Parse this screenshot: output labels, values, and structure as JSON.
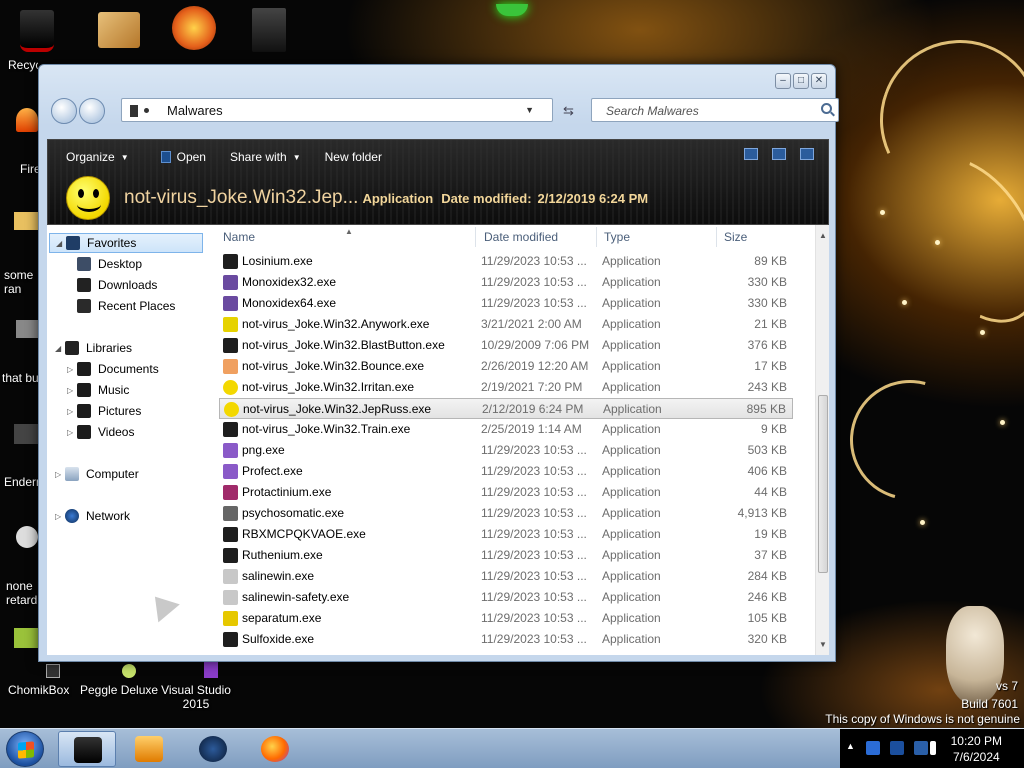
{
  "desktop": {
    "icons_bottom": [
      {
        "label": "ChomikBox"
      },
      {
        "label": "Peggle Deluxe"
      },
      {
        "label": "Visual Studio 2015"
      }
    ],
    "partial_labels": [
      {
        "label": "Recycle Bin"
      },
      {
        "label": "Fire"
      },
      {
        "label": "some ran"
      },
      {
        "label": "that bu"
      },
      {
        "label": "Endern"
      },
      {
        "label": "none retard"
      }
    ],
    "watermark": {
      "version": "vs 7",
      "build": "Build 7601",
      "genuine": "This copy of Windows is not genuine"
    }
  },
  "window": {
    "address": {
      "path": "Malwares"
    },
    "search": {
      "placeholder": "Search Malwares"
    },
    "toolbar": {
      "organize": "Organize",
      "open": "Open",
      "share_with": "Share with",
      "new_folder": "New folder"
    },
    "details": {
      "filename": "not-virus_Joke.Win32.Jep...",
      "type": "Application",
      "date_modified_label": "Date modified:",
      "date_modified_value": "2/12/2019 6:24 PM"
    },
    "nav": {
      "favorites": "Favorites",
      "desktop": "Desktop",
      "downloads": "Downloads",
      "recent_places": "Recent Places",
      "libraries": "Libraries",
      "documents": "Documents",
      "music": "Music",
      "pictures": "Pictures",
      "videos": "Videos",
      "computer": "Computer",
      "network": "Network"
    },
    "columns": {
      "name": "Name",
      "date": "Date modified",
      "type": "Type",
      "size": "Size"
    },
    "files": [
      {
        "name": "Losinium.exe",
        "date": "11/29/2023 10:53 ...",
        "type": "Application",
        "size": "89 KB",
        "icon": "dark-terminal-icon"
      },
      {
        "name": "Monoxidex32.exe",
        "date": "11/29/2023 10:53 ...",
        "type": "Application",
        "size": "330 KB",
        "icon": "gear-app-icon"
      },
      {
        "name": "Monoxidex64.exe",
        "date": "11/29/2023 10:53 ...",
        "type": "Application",
        "size": "330 KB",
        "icon": "gear-app-icon"
      },
      {
        "name": "not-virus_Joke.Win32.Anywork.exe",
        "date": "3/21/2021 2:00 AM",
        "type": "Application",
        "size": "21 KB",
        "icon": "pencil-icon"
      },
      {
        "name": "not-virus_Joke.Win32.BlastButton.exe",
        "date": "10/29/2009 7:06 PM",
        "type": "Application",
        "size": "376 KB",
        "icon": "dark-terminal-icon"
      },
      {
        "name": "not-virus_Joke.Win32.Bounce.exe",
        "date": "2/26/2019 12:20 AM",
        "type": "Application",
        "size": "17 KB",
        "icon": "orange-app-icon"
      },
      {
        "name": "not-virus_Joke.Win32.Irritan.exe",
        "date": "2/19/2021 7:20 PM",
        "type": "Application",
        "size": "243 KB",
        "icon": "smiley-icon"
      },
      {
        "name": "not-virus_Joke.Win32.JepRuss.exe",
        "date": "2/12/2019 6:24 PM",
        "type": "Application",
        "size": "895 KB",
        "icon": "smiley-icon",
        "selected": true
      },
      {
        "name": "not-virus_Joke.Win32.Train.exe",
        "date": "2/25/2019 1:14 AM",
        "type": "Application",
        "size": "9 KB",
        "icon": "dark-terminal-icon"
      },
      {
        "name": "png.exe",
        "date": "11/29/2023 10:53 ...",
        "type": "Application",
        "size": "503 KB",
        "icon": "purple-app-icon"
      },
      {
        "name": "Profect.exe",
        "date": "11/29/2023 10:53 ...",
        "type": "Application",
        "size": "406 KB",
        "icon": "purple-app-icon"
      },
      {
        "name": "Protactinium.exe",
        "date": "11/29/2023 10:53 ...",
        "type": "Application",
        "size": "44 KB",
        "icon": "red-purple-app-icon"
      },
      {
        "name": "psychosomatic.exe",
        "date": "11/29/2023 10:53 ...",
        "type": "Application",
        "size": "4,913 KB",
        "icon": "gray-app-icon"
      },
      {
        "name": "RBXMCPQKVAOE.exe",
        "date": "11/29/2023 10:53 ...",
        "type": "Application",
        "size": "19 KB",
        "icon": "dark-terminal-icon"
      },
      {
        "name": "Ruthenium.exe",
        "date": "11/29/2023 10:53 ...",
        "type": "Application",
        "size": "37 KB",
        "icon": "dark-terminal-icon"
      },
      {
        "name": "salinewin.exe",
        "date": "11/29/2023 10:53 ...",
        "type": "Application",
        "size": "284 KB",
        "icon": "bottle-icon"
      },
      {
        "name": "salinewin-safety.exe",
        "date": "11/29/2023 10:53 ...",
        "type": "Application",
        "size": "246 KB",
        "icon": "bottle-icon"
      },
      {
        "name": "separatum.exe",
        "date": "11/29/2023 10:53 ...",
        "type": "Application",
        "size": "105 KB",
        "icon": "warning-icon"
      },
      {
        "name": "Sulfoxide.exe",
        "date": "11/29/2023 10:53 ...",
        "type": "Application",
        "size": "320 KB",
        "icon": "dark-terminal-icon"
      }
    ]
  },
  "taskbar": {
    "clock_time": "10:20 PM",
    "clock_date": "7/6/2024"
  },
  "colors": {
    "selection_border": "#7eb4ea",
    "toolbar_bg": "#0c0c0c",
    "detail_text": "#f3d79a",
    "taskbar": "#8fa9c8"
  }
}
